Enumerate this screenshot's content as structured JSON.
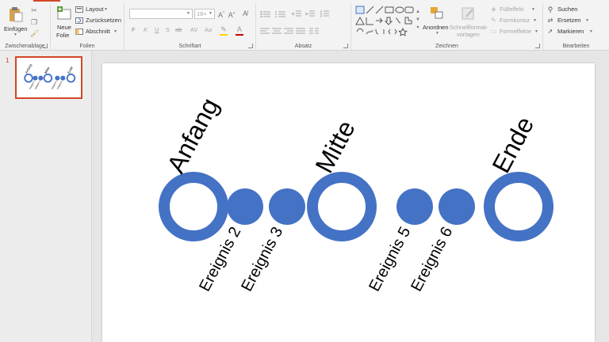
{
  "theme": {
    "accent": "#d24726",
    "shape_fill": "#4472c4",
    "ribbon_bg": "#f3f3f3",
    "canvas_bg": "#e6e6e6"
  },
  "ribbon": {
    "clipboard": {
      "label": "Zwischenablage",
      "paste": "Einfügen",
      "icons": [
        "paste-icon",
        "cut-icon",
        "copy-icon",
        "format-painter-icon"
      ]
    },
    "slides": {
      "label": "Folien",
      "new_slide_line1": "Neue",
      "new_slide_line2": "Folie",
      "layout": "Layout",
      "reset": "Zurücksetzen",
      "section": "Abschnitt"
    },
    "font": {
      "label": "Schriftart",
      "font_name": "",
      "font_size": "18+",
      "style_buttons": [
        "F",
        "K",
        "U",
        "S",
        "ab",
        "AV",
        "Aa"
      ]
    },
    "paragraph": {
      "label": "Absatz"
    },
    "drawing": {
      "label": "Zeichnen",
      "arrange": "Anordnen",
      "quick_styles_line1": "Schnellformat-",
      "quick_styles_line2": "vorlagen",
      "shape_fill": "Fülleffekt",
      "shape_outline": "Formkontur",
      "shape_effects": "Formeffekte"
    },
    "editing": {
      "label": "Bearbeiten",
      "find": "Suchen",
      "replace": "Ersetzen",
      "select": "Markieren"
    }
  },
  "thumbnails": {
    "slide_number": "1"
  },
  "slide": {
    "milestones": [
      {
        "label": "Anfang",
        "kind": "major"
      },
      {
        "label": "Ereignis 2",
        "kind": "minor"
      },
      {
        "label": "Ereignis 3",
        "kind": "minor"
      },
      {
        "label": "Mitte",
        "kind": "major"
      },
      {
        "label": "Ereignis 5",
        "kind": "minor"
      },
      {
        "label": "Ereignis 6",
        "kind": "minor"
      },
      {
        "label": "Ende",
        "kind": "major"
      }
    ]
  }
}
